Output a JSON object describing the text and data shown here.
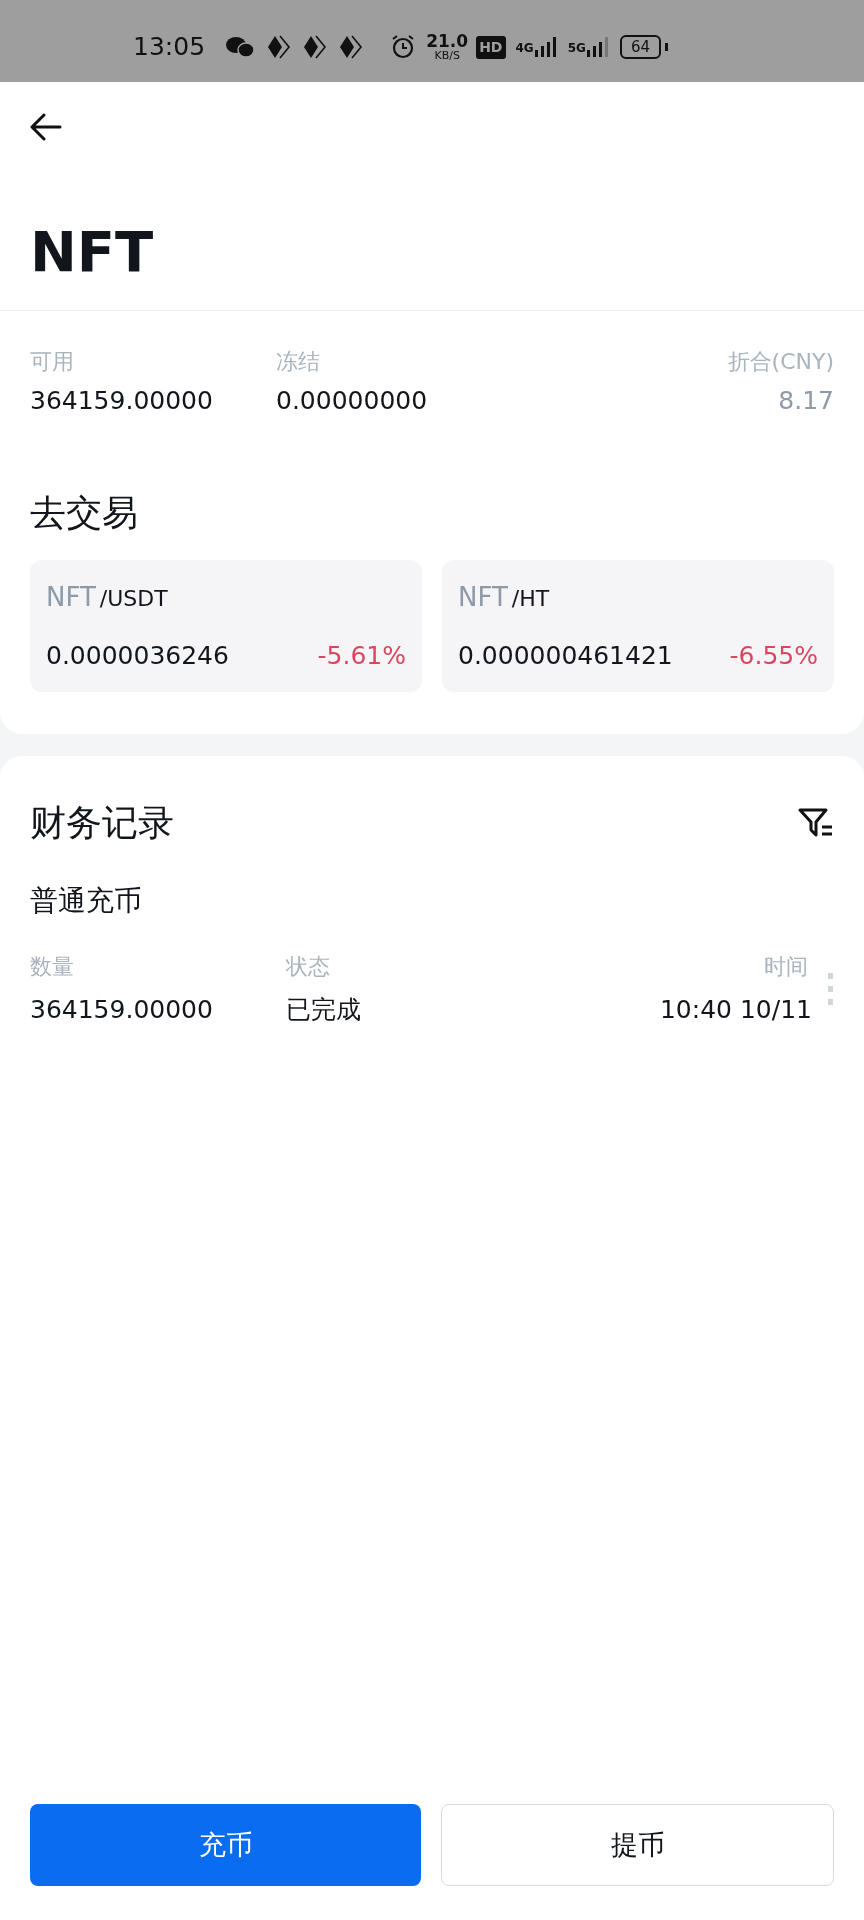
{
  "status_bar": {
    "time": "13:05",
    "speed": "21.0",
    "speed_unit": "KB/S",
    "hd": "HD",
    "networks": [
      "4G",
      "5G"
    ],
    "battery": "64"
  },
  "header": {
    "title": "NFT"
  },
  "balances": [
    {
      "label": "可用",
      "value": "364159.00000",
      "kind": "amount"
    },
    {
      "label": "冻结",
      "value": "0.00000000",
      "kind": "amount"
    },
    {
      "label": "折合(CNY)",
      "value": "8.17",
      "kind": "converted"
    }
  ],
  "trade": {
    "title": "去交易",
    "pairs": [
      {
        "base": "NFT",
        "quote": "/USDT",
        "price": "0.0000036246",
        "change": "-5.61%"
      },
      {
        "base": "NFT",
        "quote": "/HT",
        "price": "0.000000461421",
        "change": "-6.55%"
      }
    ]
  },
  "records": {
    "title": "财务记录",
    "section": "普通充币",
    "columns": [
      "数量",
      "状态",
      "时间"
    ],
    "rows": [
      {
        "amount": "364159.00000",
        "status": "已完成",
        "time": "10:40 10/11"
      }
    ]
  },
  "buttons": [
    {
      "label": "充币",
      "kind": "primary"
    },
    {
      "label": "提币",
      "kind": "outline"
    }
  ]
}
